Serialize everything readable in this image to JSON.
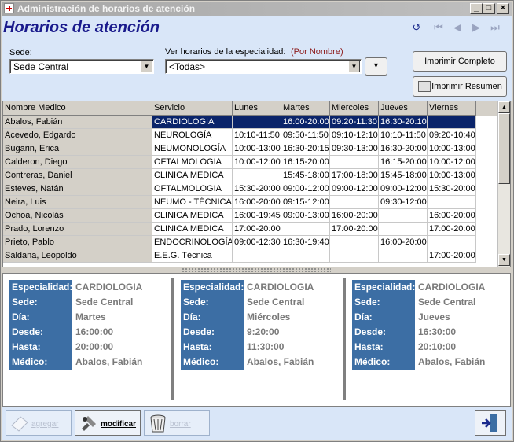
{
  "window": {
    "title": "Administración de horarios de atención"
  },
  "header": {
    "title": "Horarios de atención"
  },
  "filters": {
    "sede_label": "Sede:",
    "sede_value": "Sede Central",
    "especialidad_label": "Ver horarios de la especialidad:",
    "sort_label": "(Por Nombre)",
    "especialidad_value": "<Todas>"
  },
  "actions": {
    "print_full": "Imprimir Completo",
    "print_summary": "Imprimir Resumen"
  },
  "grid": {
    "headers": [
      "Nombre Medico",
      "Servicio",
      "Lunes",
      "Martes",
      "Miercoles",
      "Jueves",
      "Viernes"
    ],
    "rows": [
      [
        "Abalos, Fabián",
        "CARDIOLOGIA",
        "",
        "16:00-20:00",
        "09:20-11:30",
        "16:30-20:10",
        ""
      ],
      [
        "Acevedo, Edgardo",
        "NEUROLOGÍA",
        "10:10-11:50",
        "09:50-11:50",
        "09:10-12:10",
        "10:10-11:50",
        "09:20-10:40"
      ],
      [
        "Bugarin, Erica",
        "NEUMONOLOGÍA",
        "10:00-13:00",
        "16:30-20:15",
        "09:30-13:00",
        "16:30-20:00",
        "10:00-13:00"
      ],
      [
        "Calderon, Diego",
        "OFTALMOLOGIA",
        "10:00-12:00",
        "16:15-20:00",
        "",
        "16:15-20:00",
        "10:00-12:00"
      ],
      [
        "Contreras, Daniel",
        "CLINICA MEDICA",
        "",
        "15:45-18:00",
        "17:00-18:00",
        "15:45-18:00",
        "10:00-13:00"
      ],
      [
        "Esteves, Natán",
        "OFTALMOLOGIA",
        "15:30-20:00",
        "09:00-12:00",
        "09:00-12:00",
        "09:00-12:00",
        "15:30-20:00"
      ],
      [
        "Neira, Luis",
        "NEUMO - TÉCNICA",
        "16:00-20:00",
        "09:15-12:00",
        "",
        "09:30-12:00",
        ""
      ],
      [
        "Ochoa, Nicolás",
        "CLINICA MEDICA",
        "16:00-19:45",
        "09:00-13:00",
        "16:00-20:00",
        "",
        "16:00-20:00"
      ],
      [
        "Prado, Lorenzo",
        "CLINICA MEDICA",
        "17:00-20:00",
        "",
        "17:00-20:00",
        "",
        "17:00-20:00"
      ],
      [
        "Prieto, Pablo",
        "ENDOCRINOLOGÍA",
        "09:00-12:30",
        "16:30-19:40",
        "",
        "16:00-20:00",
        ""
      ],
      [
        "Saldana, Leopoldo",
        "E.E.G. Técnica",
        "",
        "",
        "",
        "",
        "17:00-20:00"
      ]
    ]
  },
  "detail_labels": [
    "Especialidad:",
    "Sede:",
    "Día:",
    "Desde:",
    "Hasta:",
    "Médico:"
  ],
  "detail_cards": [
    [
      "CARDIOLOGIA",
      "Sede Central",
      "Martes",
      "16:00:00",
      "20:00:00",
      "Abalos, Fabián"
    ],
    [
      "CARDIOLOGIA",
      "Sede Central",
      "Miércoles",
      "9:20:00",
      "11:30:00",
      "Abalos, Fabián"
    ],
    [
      "CARDIOLOGIA",
      "Sede Central",
      "Jueves",
      "16:30:00",
      "20:10:00",
      "Abalos, Fabián"
    ]
  ],
  "bottom": {
    "add": "agregar",
    "modify": "modificar",
    "delete": "borrar"
  },
  "colors": {
    "header_bg": "#d9e6f8",
    "title": "#1a1a8c",
    "selection": "#0a246a",
    "detail_label_bg": "#3c6ea4"
  }
}
